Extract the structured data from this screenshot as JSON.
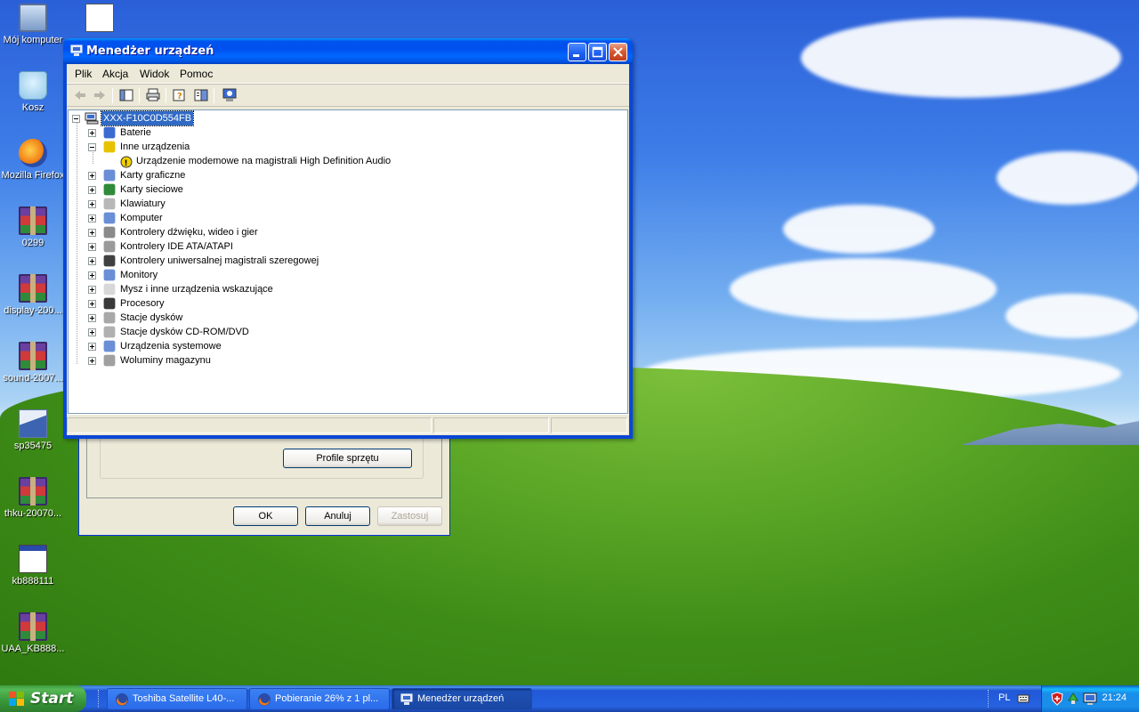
{
  "desktop": {
    "icons": [
      {
        "label": "Mój komputer",
        "icon": "my-computer-icon"
      },
      {
        "label": "Kosz",
        "icon": "recycle-bin-icon"
      },
      {
        "label": "Mozilla Firefox",
        "icon": "firefox-icon"
      },
      {
        "label": "0299",
        "icon": "winrar-archive-icon"
      },
      {
        "label": "display-200...",
        "icon": "winrar-archive-icon"
      },
      {
        "label": "sound-2007...",
        "icon": "winrar-archive-icon"
      },
      {
        "label": "sp35475",
        "icon": "installer-icon"
      },
      {
        "label": "thku-20070...",
        "icon": "winrar-archive-icon"
      },
      {
        "label": "kb888111",
        "icon": "application-window-icon"
      },
      {
        "label": "UAA_KB888...",
        "icon": "winrar-archive-icon"
      }
    ]
  },
  "background_dialog": {
    "hardware_profiles_button": "Profile sprzętu",
    "ok_button": "OK",
    "cancel_button": "Anuluj",
    "apply_button": "Zastosuj"
  },
  "window": {
    "title": "Menedżer urządzeń",
    "menu": [
      "Plik",
      "Akcja",
      "Widok",
      "Pomoc"
    ],
    "toolbar": [
      "back-arrow-icon",
      "forward-arrow-icon",
      "show-hide-console-tree-icon",
      "print-icon",
      "help-icon",
      "properties-icon",
      "scan-hardware-icon"
    ],
    "tree": {
      "root": "XXX-F10C0D554FB",
      "nodes": [
        {
          "label": "Baterie",
          "icon": "battery-icon",
          "expanded": false
        },
        {
          "label": "Inne urządzenia",
          "icon": "unknown-device-icon",
          "expanded": true,
          "children": [
            {
              "label": "Urządzenie modemowe na magistrali High Definition Audio",
              "icon": "warning-device-icon"
            }
          ]
        },
        {
          "label": "Karty graficzne",
          "icon": "display-adapter-icon",
          "expanded": false
        },
        {
          "label": "Karty sieciowe",
          "icon": "network-card-icon",
          "expanded": false
        },
        {
          "label": "Klawiatury",
          "icon": "keyboard-icon",
          "expanded": false
        },
        {
          "label": "Komputer",
          "icon": "computer-icon",
          "expanded": false
        },
        {
          "label": "Kontrolery dźwięku, wideo i gier",
          "icon": "sound-icon",
          "expanded": false
        },
        {
          "label": "Kontrolery IDE ATA/ATAPI",
          "icon": "ide-controller-icon",
          "expanded": false
        },
        {
          "label": "Kontrolery uniwersalnej magistrali szeregowej",
          "icon": "usb-icon",
          "expanded": false
        },
        {
          "label": "Monitory",
          "icon": "monitor-icon",
          "expanded": false
        },
        {
          "label": "Mysz i inne urządzenia wskazujące",
          "icon": "mouse-icon",
          "expanded": false
        },
        {
          "label": "Procesory",
          "icon": "processor-icon",
          "expanded": false
        },
        {
          "label": "Stacje dysków",
          "icon": "disk-drive-icon",
          "expanded": false
        },
        {
          "label": "Stacje dysków CD-ROM/DVD",
          "icon": "cdrom-icon",
          "expanded": false
        },
        {
          "label": "Urządzenia systemowe",
          "icon": "system-device-icon",
          "expanded": false
        },
        {
          "label": "Woluminy magazynu",
          "icon": "storage-volume-icon",
          "expanded": false
        }
      ]
    }
  },
  "taskbar": {
    "start_label": "Start",
    "tasks": [
      {
        "label": "Toshiba Satellite L40-...",
        "icon": "firefox-icon",
        "active": false
      },
      {
        "label": "Pobieranie 26% z 1 pl...",
        "icon": "firefox-icon",
        "active": false
      },
      {
        "label": "Menedżer urządzeń",
        "icon": "device-manager-icon",
        "active": true
      }
    ],
    "language": "PL",
    "tray_icons": [
      "keyboard-layout-icon",
      "security-shield-icon",
      "network-icon",
      "display-settings-icon"
    ],
    "clock": "21:24"
  }
}
